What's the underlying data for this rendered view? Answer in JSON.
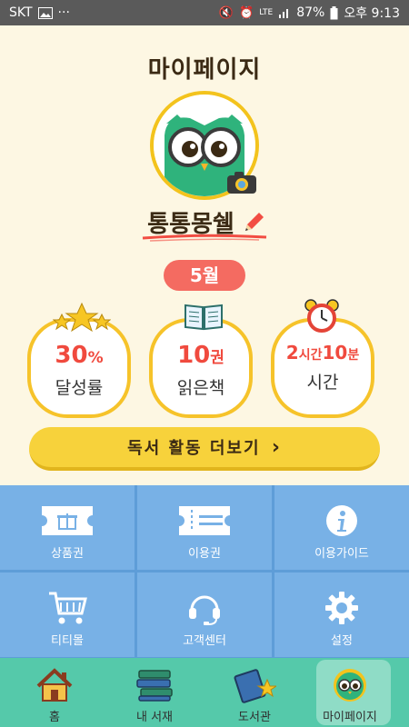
{
  "status_bar": {
    "carrier": "SKT",
    "image_icon": "image-icon",
    "more": "···",
    "network": "LTE",
    "battery": "87%",
    "time": "오후 9:13"
  },
  "page": {
    "title": "마이페이지",
    "nickname": "통통몽쉘",
    "month": "5월"
  },
  "stats": [
    {
      "value": "30",
      "unit": "%",
      "label": "달성률",
      "icon": "stars-icon"
    },
    {
      "value": "10",
      "unit": "권",
      "label": "읽은책",
      "icon": "open-book-icon"
    },
    {
      "value_hours": "2",
      "unit_hours": "시간",
      "value_minutes": "10",
      "unit_minutes": "분",
      "label": "시간",
      "icon": "alarm-clock-icon"
    }
  ],
  "more_button": {
    "label": "독서 활동 더보기",
    "chevron": "›"
  },
  "menu": [
    {
      "label": "상품권",
      "icon": "gift-icon"
    },
    {
      "label": "이용권",
      "icon": "ticket-icon"
    },
    {
      "label": "이용가이드",
      "icon": "info-icon"
    },
    {
      "label": "티티몰",
      "icon": "cart-icon"
    },
    {
      "label": "고객센터",
      "icon": "headset-icon"
    },
    {
      "label": "설정",
      "icon": "gear-icon"
    }
  ],
  "bottom_nav": [
    {
      "label": "홈",
      "icon": "home-icon"
    },
    {
      "label": "내 서재",
      "icon": "books-icon"
    },
    {
      "label": "도서관",
      "icon": "library-icon"
    },
    {
      "label": "마이페이지",
      "icon": "owl-icon",
      "active": true
    }
  ],
  "colors": {
    "background": "#fdf7e3",
    "accent_yellow": "#f6c32a",
    "accent_red": "#f04a3e",
    "grid_blue": "#78b1e6",
    "nav_green": "#55c9aa"
  }
}
